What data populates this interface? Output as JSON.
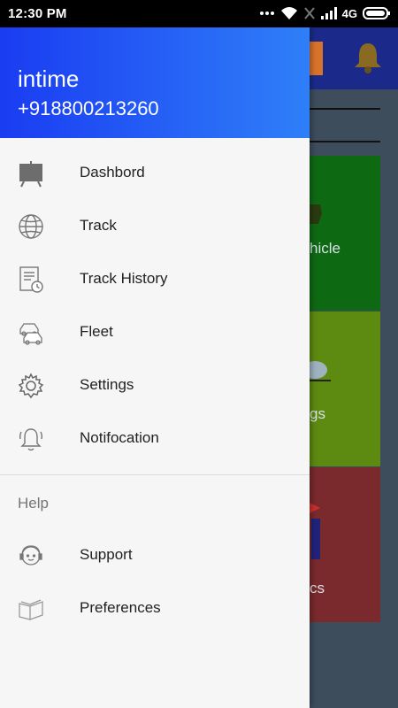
{
  "status_bar": {
    "time": "12:30 PM",
    "network": "4G"
  },
  "drawer": {
    "header": {
      "name": "intime",
      "phone": "+918800213260"
    },
    "items": [
      {
        "label": "Dashbord",
        "icon": "dashboard-board-icon"
      },
      {
        "label": "Track",
        "icon": "globe-icon"
      },
      {
        "label": "Track History",
        "icon": "document-clock-icon"
      },
      {
        "label": "Fleet",
        "icon": "cars-icon"
      },
      {
        "label": "Settings",
        "icon": "gear-icon"
      },
      {
        "label": "Notifocation",
        "icon": "bell-icon"
      }
    ],
    "help_section": {
      "title": "Help",
      "items": [
        {
          "label": "Support",
          "icon": "support-agent-icon"
        },
        {
          "label": "Preferences",
          "icon": "book-icon"
        }
      ]
    }
  },
  "background": {
    "tiles": [
      {
        "label": "hicle",
        "color": "#0e6a12"
      },
      {
        "label": "gs",
        "color": "#5d8a10"
      },
      {
        "label": "cs",
        "color": "#7a2a2c"
      }
    ]
  }
}
